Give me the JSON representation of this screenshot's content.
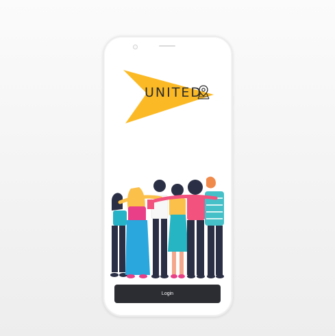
{
  "app": {
    "brand_name": "UNITED",
    "brand_colors": {
      "accent": "#FBBA25",
      "ink": "#2B2B2B"
    },
    "icons": [
      "map-pin-icon"
    ]
  },
  "illustration": {
    "subject": "group-hug-people"
  },
  "actions": {
    "login_label": "Login",
    "button_color": "#2B2D33"
  }
}
